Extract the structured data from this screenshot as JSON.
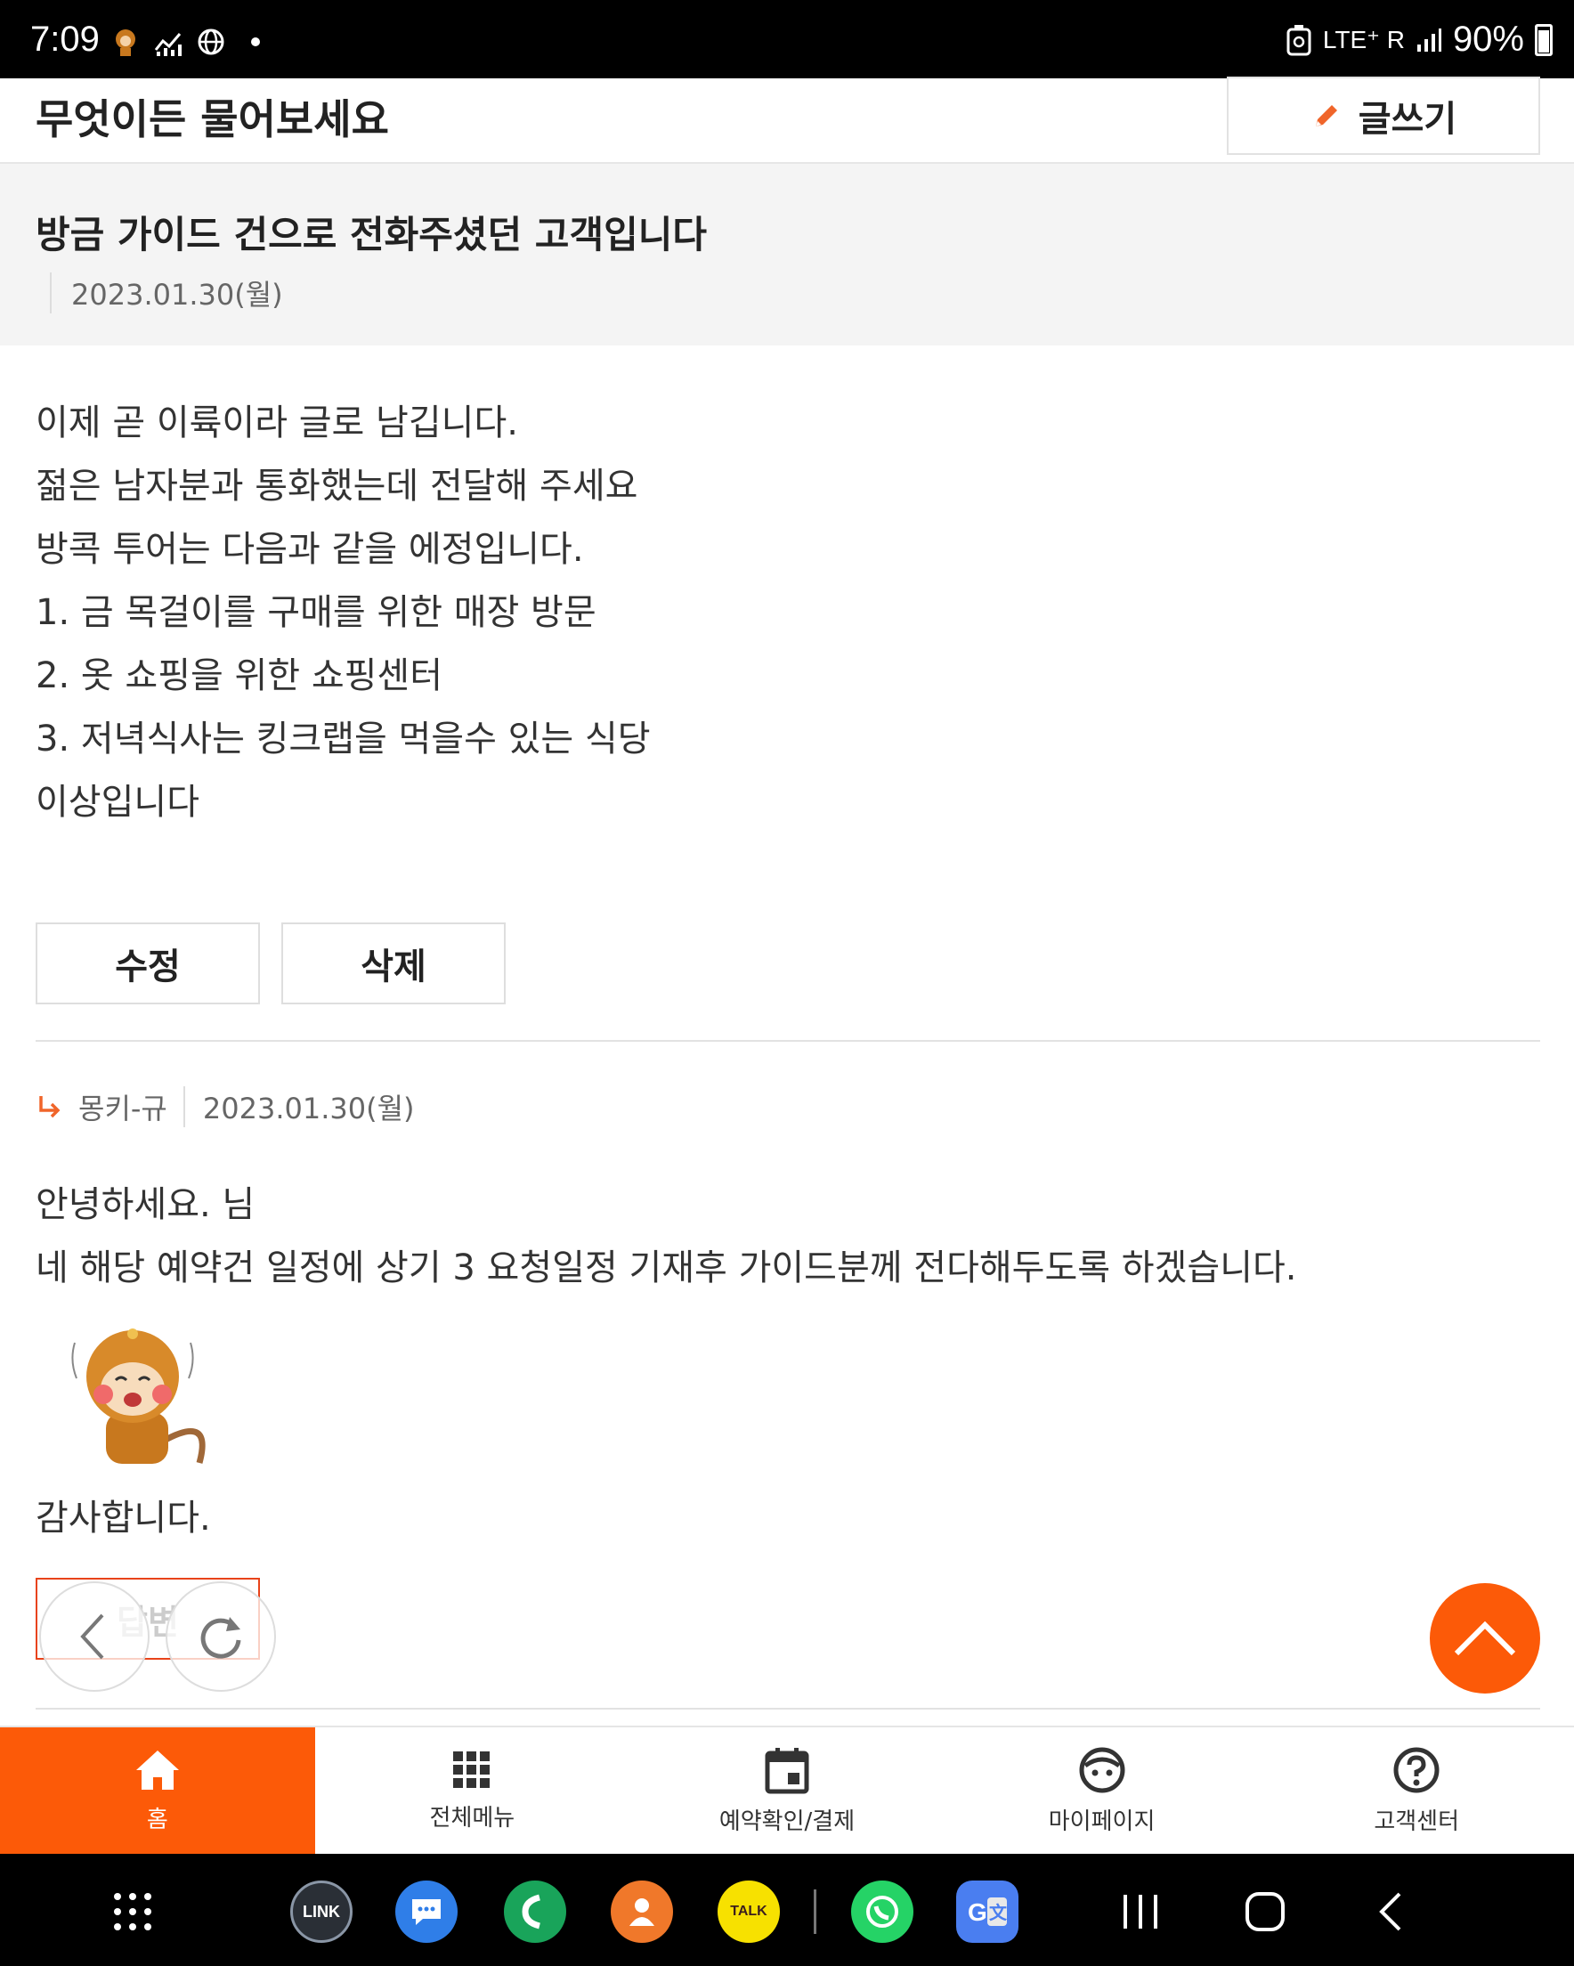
{
  "status_bar": {
    "time": "7:09",
    "network": "LTE⁺ R",
    "battery": "90%"
  },
  "header": {
    "title": "무엇이든 물어보세요",
    "write_label": "글쓰기"
  },
  "post": {
    "title": "방금 가이드 건으로 전화주셨던 고객입니다",
    "date": "2023.01.30(월)",
    "body_lines": [
      "이제 곧 이륙이라 글로 남깁니다.",
      "젊은 남자분과 통화했는데 전달해 주세요",
      "방콕 투어는 다음과 같을 에정입니다.",
      "1. 금 목걸이를 구매를 위한 매장 방문",
      "2. 옷 쇼핑을 위한 쇼핑센터",
      "3. 저녁식사는 킹크랩을 먹을수 있는 식당",
      "이상입니다"
    ],
    "edit_label": "수정",
    "delete_label": "삭제"
  },
  "reply": {
    "author": "몽키-규",
    "date": "2023.01.30(월)",
    "lines": [
      "안녕하세요. 님",
      "네 해당 예약건 일정에 상기 3 요청일정 기재후 가이드분께 전다해두도록 하겠습니다."
    ],
    "thanks": "감사합니다.",
    "answer_label": "답변"
  },
  "bottom_nav": [
    {
      "label": "홈",
      "icon": "home-icon",
      "active": true
    },
    {
      "label": "전체메뉴",
      "icon": "grid-icon",
      "active": false
    },
    {
      "label": "예약확인/결제",
      "icon": "calendar-icon",
      "active": false
    },
    {
      "label": "마이페이지",
      "icon": "face-icon",
      "active": false
    },
    {
      "label": "고객센터",
      "icon": "help-icon",
      "active": false
    }
  ],
  "system_apps": [
    {
      "label": "LINK",
      "icon": "tlink-app-icon",
      "color": "#2a2f36"
    },
    {
      "label": "",
      "icon": "messages-app-icon",
      "color": "#2f7ee8"
    },
    {
      "label": "",
      "icon": "phone-app-icon",
      "color": "#19a45a"
    },
    {
      "label": "",
      "icon": "contacts-app-icon",
      "color": "#f0782a"
    },
    {
      "label": "TALK",
      "icon": "kakaotalk-app-icon",
      "color": "#f7e100"
    },
    {
      "label": "",
      "icon": "whatsapp-app-icon",
      "color": "#25d366"
    },
    {
      "label": "",
      "icon": "google-translate-app-icon",
      "color": "#4a7ef0"
    }
  ],
  "colors": {
    "accent": "#fc5a08",
    "answer_border": "#e8431a"
  }
}
